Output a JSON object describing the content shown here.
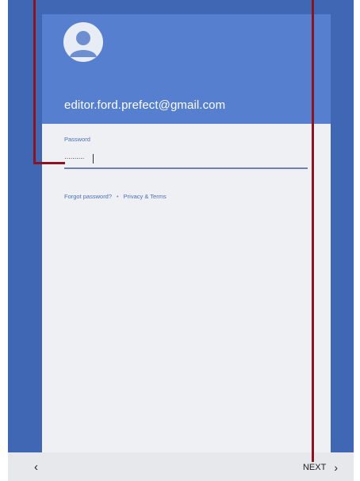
{
  "account": {
    "email": "editor.ford.prefect@gmail.com"
  },
  "password": {
    "label": "Password",
    "masked_value": "··········"
  },
  "links": {
    "forgot_password": "Forgot password?",
    "separator": "•",
    "privacy_terms": "Privacy & Terms"
  },
  "nav": {
    "back_icon": "‹",
    "next_label": "NEXT",
    "next_icon": "›"
  },
  "colors": {
    "frame_blue": "#3f67b4",
    "header_blue": "#5680cf",
    "callout_red": "#8b1420"
  }
}
